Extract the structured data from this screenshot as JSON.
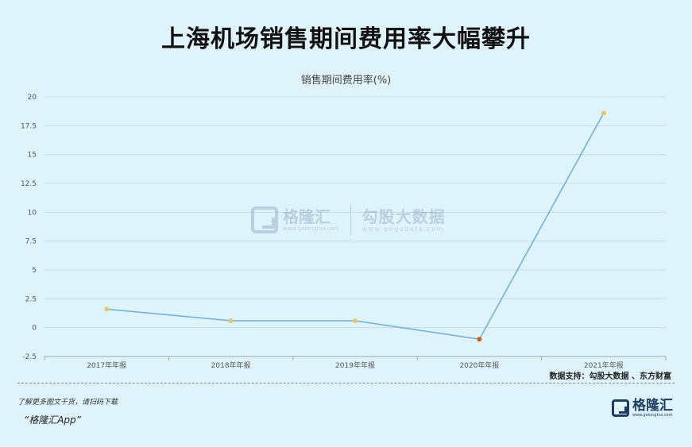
{
  "header": {
    "title": "上海机场销售期间费用率大幅攀升"
  },
  "chart_data": {
    "type": "line",
    "title": "销售期间费用率(%)",
    "categories": [
      "2017年年报",
      "2018年年报",
      "2019年年报",
      "2020年年报",
      "2021年年报"
    ],
    "series": [
      {
        "values": [
          1.6,
          0.6,
          0.6,
          -1.0,
          18.6
        ]
      }
    ],
    "ylim": [
      -2.5,
      20
    ],
    "yticks": [
      "-2.5",
      "0",
      "2.5",
      "5",
      "7.5",
      "10",
      "12.5",
      "15",
      "17.5",
      "20"
    ],
    "grid": true,
    "colors": {
      "line": "#6aaee0",
      "point": "#e9c46a",
      "highlight_point": "#d65a12"
    },
    "highlight_index": 3
  },
  "watermark": {
    "name": "格隆汇",
    "url": "www.gelonghui.com",
    "name2": "勾股大数据",
    "url2": "www.gogudata.com"
  },
  "source": "数据支持：勾股大数据 、东方财富",
  "footer": {
    "promo": "了解更多图文干货，请扫码下载",
    "app": "“格隆汇App”",
    "brand": "格隆汇",
    "brand_url": "www.gelonghui.com"
  }
}
